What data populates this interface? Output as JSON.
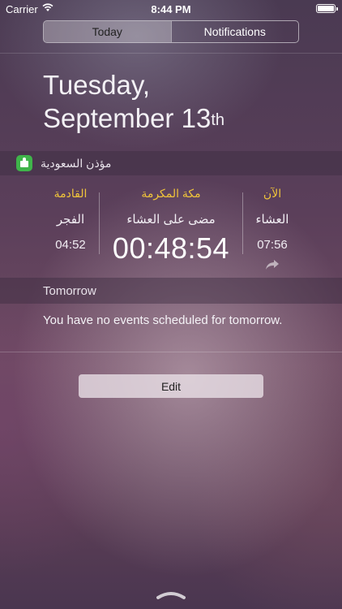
{
  "status_bar": {
    "carrier": "Carrier",
    "time": "8:44 PM"
  },
  "tabs": [
    {
      "label": "Today",
      "active": true
    },
    {
      "label": "Notifications",
      "active": false
    }
  ],
  "date": {
    "line1": "Tuesday,",
    "line2": "September 13",
    "suffix": "th"
  },
  "widget": {
    "app_name": "مؤذن السعودية",
    "app_icon_color": "#3fb44a",
    "next": {
      "header": "القادمة",
      "prayer": "الفجر",
      "time": "04:52"
    },
    "center": {
      "city": "مكة المكرمة",
      "caption": "مضى على العشاء",
      "elapsed": "00:48:54"
    },
    "now": {
      "header": "الآن",
      "prayer": "العشاء",
      "time": "07:56"
    },
    "accent_color": "#f0c43a"
  },
  "tomorrow": {
    "header": "Tomorrow",
    "message": "You have no events scheduled for tomorrow."
  },
  "edit_button": {
    "label": "Edit"
  }
}
